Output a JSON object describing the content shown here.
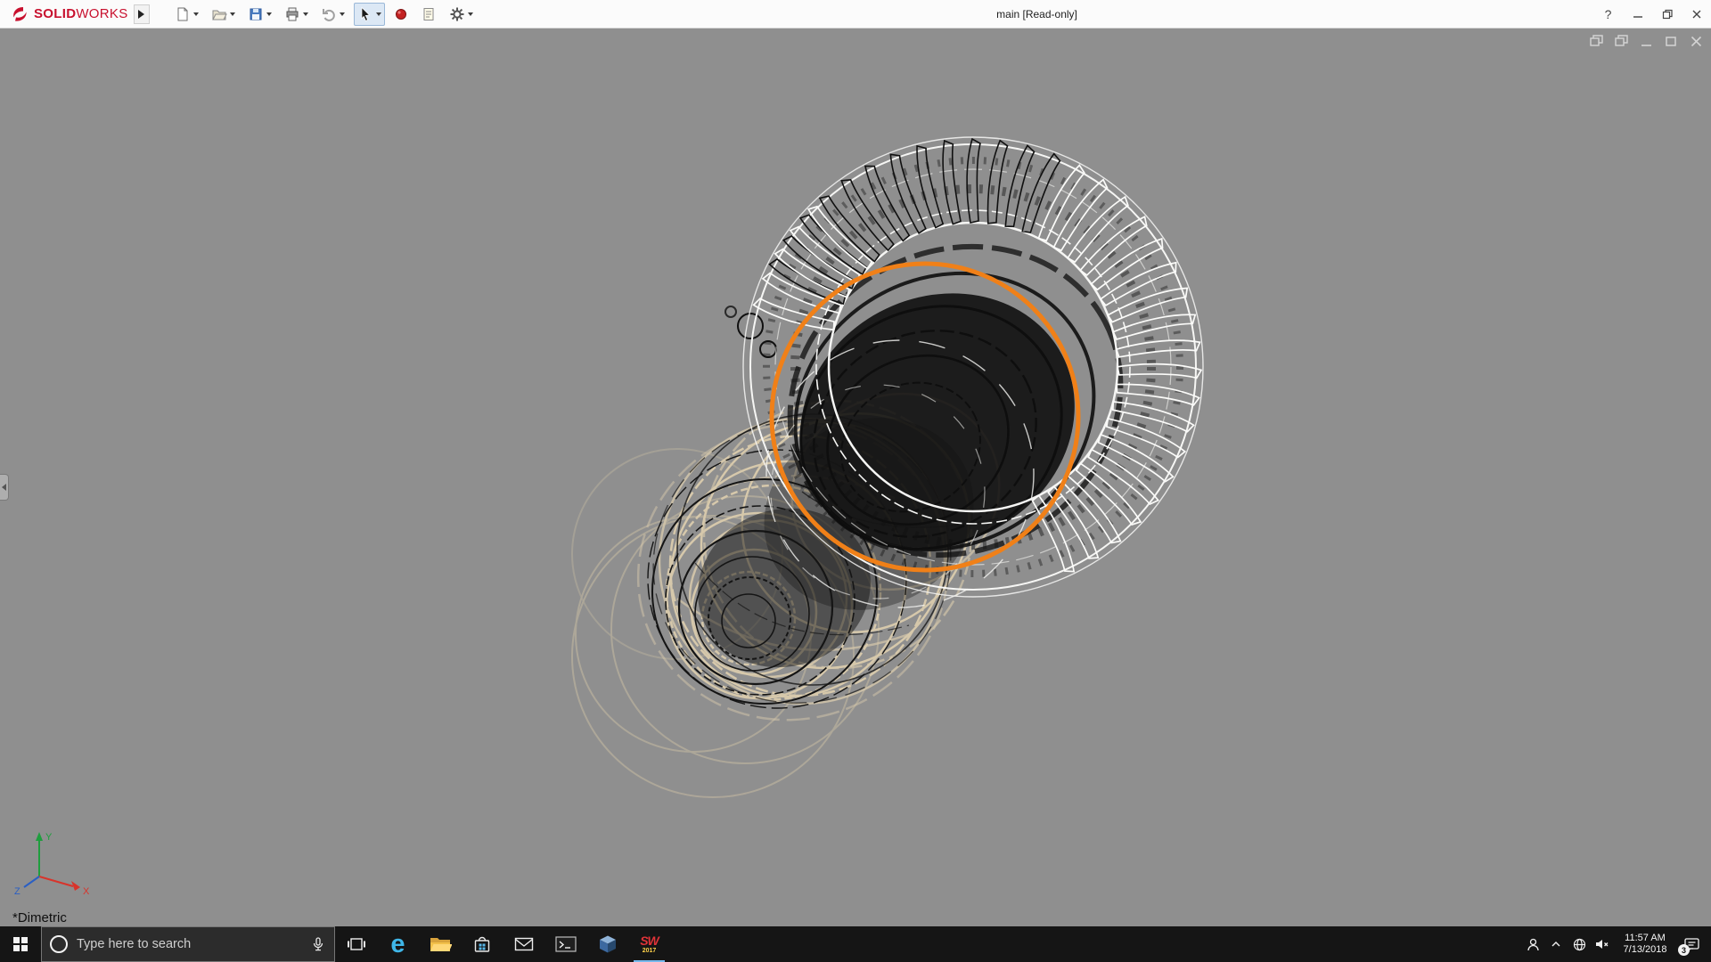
{
  "window": {
    "title": "main [Read-only]",
    "brand_solid": "SOLID",
    "brand_works": "WORKS",
    "help_label": "?"
  },
  "toolbar": {
    "icons": [
      "new-document",
      "open",
      "save",
      "print",
      "undo",
      "select-arrow",
      "appearance-dot",
      "design-binder",
      "options-gear"
    ]
  },
  "viewport": {
    "view_orientation_label": "*Dimetric",
    "triad": {
      "x_label": "X",
      "y_label": "Y",
      "z_label": "Z"
    },
    "colors": {
      "background": "#8F8F8F",
      "selection_orange": "#F08018",
      "wire_tan": "#D6C8AB",
      "wire_black": "#121212",
      "wire_white": "#F6F6F4"
    }
  },
  "taskbar": {
    "search": {
      "placeholder": "Type here to search"
    },
    "edge_glyph": "e",
    "solidworks_year": "2017",
    "apps": [
      "task-view",
      "edge",
      "file-explorer",
      "store",
      "mail",
      "terminal",
      "cad-cube",
      "solidworks-2017"
    ],
    "tray": {
      "time": "11:57 AM",
      "date": "7/13/2018",
      "notification_count": "3"
    }
  }
}
